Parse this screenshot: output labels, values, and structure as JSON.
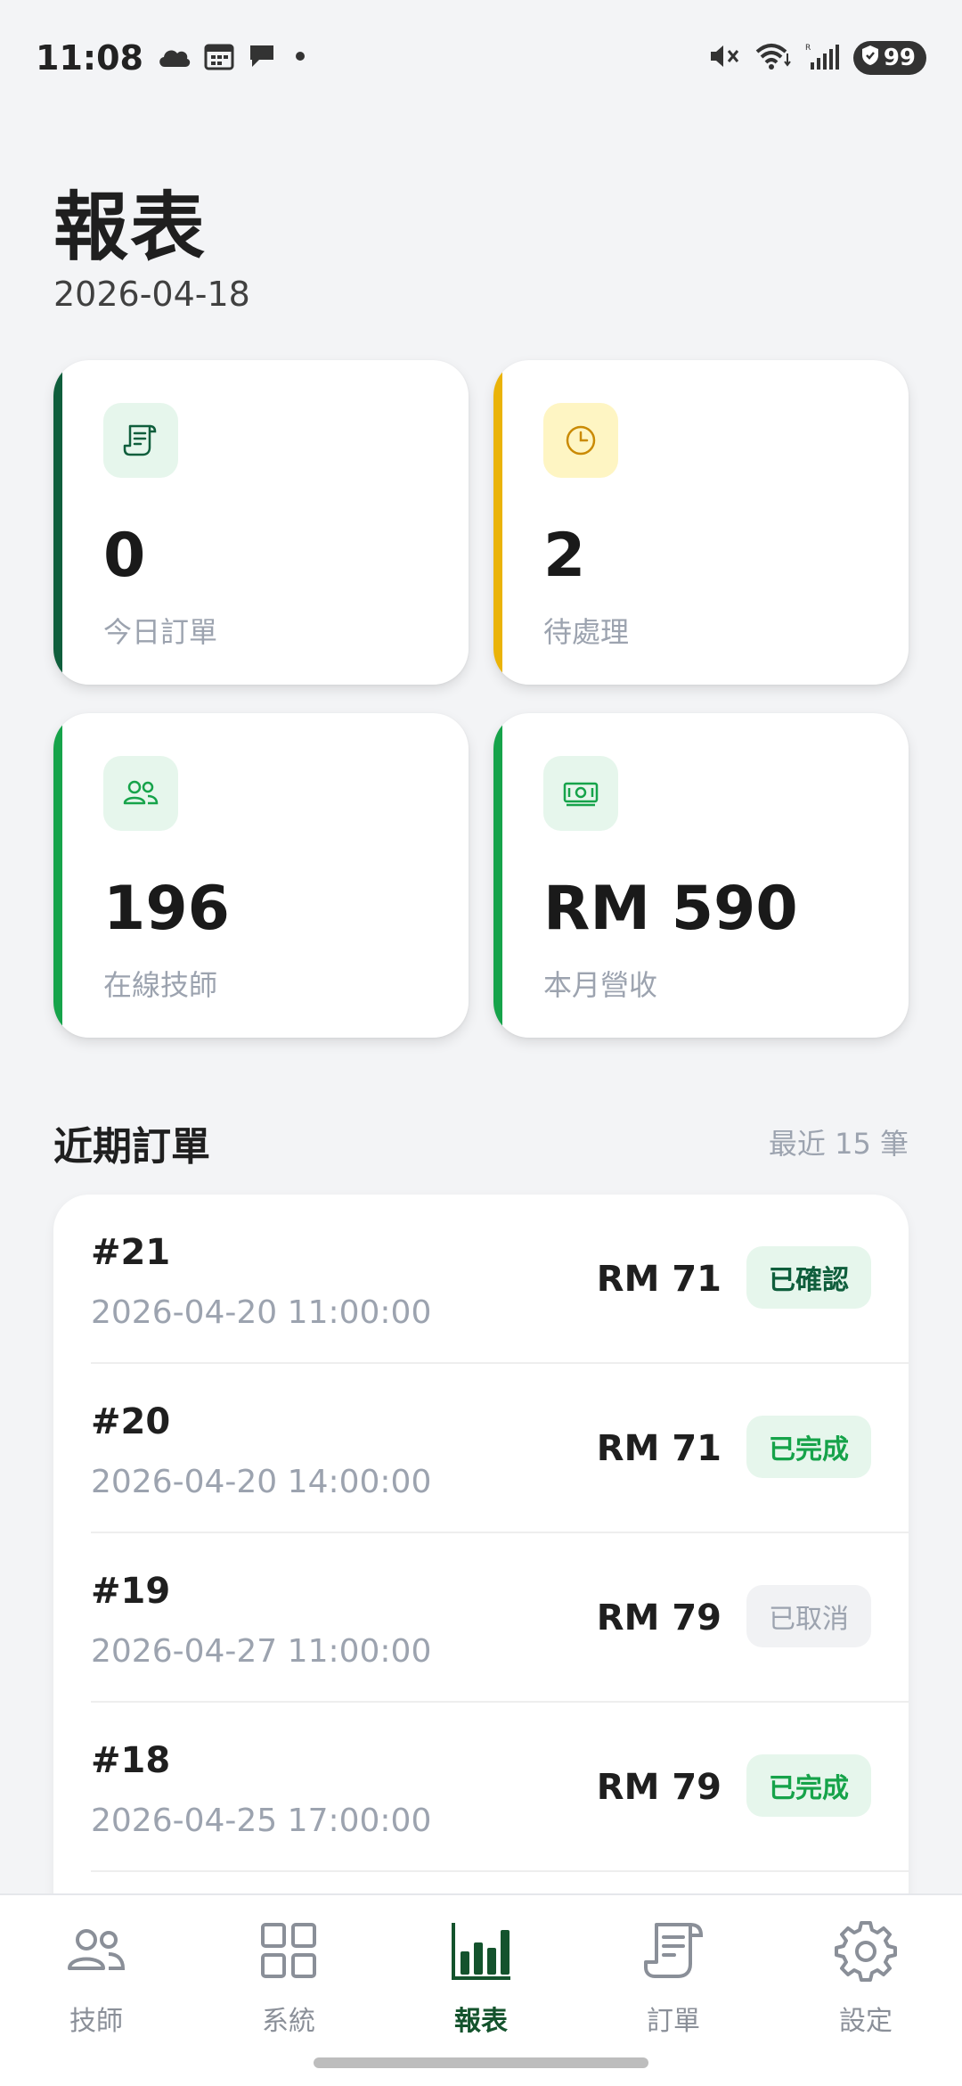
{
  "status_bar": {
    "time": "11:08",
    "battery": "99",
    "left_icons": [
      "cloud-icon",
      "calendar-icon",
      "chat-icon",
      "dot-icon"
    ],
    "right_icons": [
      "mute-icon",
      "wifi-icon",
      "signal-icon",
      "shield-icon"
    ]
  },
  "header": {
    "title": "報表",
    "date": "2026-04-18"
  },
  "stats": [
    {
      "icon": "receipt-icon",
      "value": "0",
      "label": "今日訂單",
      "accent": "#0F5E3C",
      "icon_bg": "#E6F6EC",
      "icon_color": "#0F5E3C"
    },
    {
      "icon": "clock-icon",
      "value": "2",
      "label": "待處理",
      "accent": "#EAB308",
      "icon_bg": "#FEF5C3",
      "icon_color": "#CA8A04"
    },
    {
      "icon": "users-icon",
      "value": "196",
      "label": "在線技師",
      "accent": "#16A34A",
      "icon_bg": "#E6F6EC",
      "icon_color": "#16A34A"
    },
    {
      "icon": "cash-icon",
      "value": "RM 590",
      "label": "本月營收",
      "accent": "#16A34A",
      "icon_bg": "#E6F6EC",
      "icon_color": "#16A34A"
    }
  ],
  "recent_orders": {
    "title": "近期訂單",
    "hint": "最近 15 筆",
    "orders": [
      {
        "id": "#21",
        "time": "2026-04-20 11:00:00",
        "amount": "RM 71",
        "status": "已確認",
        "status_type": "confirmed"
      },
      {
        "id": "#20",
        "time": "2026-04-20 14:00:00",
        "amount": "RM 71",
        "status": "已完成",
        "status_type": "completed"
      },
      {
        "id": "#19",
        "time": "2026-04-27 11:00:00",
        "amount": "RM 79",
        "status": "已取消",
        "status_type": "cancelled"
      },
      {
        "id": "#18",
        "time": "2026-04-25 17:00:00",
        "amount": "RM 79",
        "status": "已完成",
        "status_type": "completed"
      }
    ]
  },
  "bottom_nav": {
    "items": [
      {
        "label": "技師",
        "icon": "users-icon",
        "active": false
      },
      {
        "label": "系統",
        "icon": "grid-icon",
        "active": false
      },
      {
        "label": "報表",
        "icon": "bar-chart-icon",
        "active": true
      },
      {
        "label": "訂單",
        "icon": "receipt-icon",
        "active": false
      },
      {
        "label": "設定",
        "icon": "gear-icon",
        "active": false
      }
    ],
    "active_color": "#14532D",
    "inactive_color": "#8A8F98"
  }
}
